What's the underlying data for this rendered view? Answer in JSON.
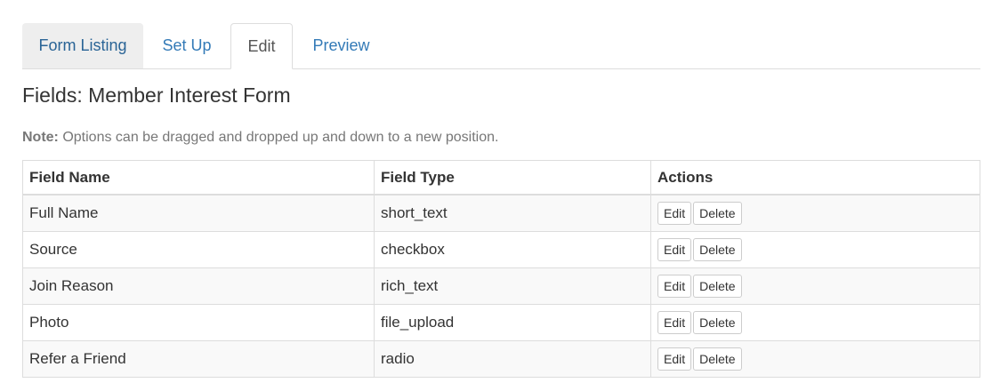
{
  "tabs": [
    {
      "label": "Form Listing"
    },
    {
      "label": "Set Up"
    },
    {
      "label": "Edit"
    },
    {
      "label": "Preview"
    }
  ],
  "page_title": "Fields: Member Interest Form",
  "note": {
    "label": "Note:",
    "text": " Options can be dragged and dropped up and down to a new position."
  },
  "table": {
    "headers": [
      "Field Name",
      "Field Type",
      "Actions"
    ],
    "rows": [
      {
        "name": "Full Name",
        "type": "short_text",
        "edit": "Edit",
        "delete": "Delete"
      },
      {
        "name": "Source",
        "type": "checkbox",
        "edit": "Edit",
        "delete": "Delete"
      },
      {
        "name": "Join Reason",
        "type": "rich_text",
        "edit": "Edit",
        "delete": "Delete"
      },
      {
        "name": "Photo",
        "type": "file_upload",
        "edit": "Edit",
        "delete": "Delete"
      },
      {
        "name": "Refer a Friend",
        "type": "radio",
        "edit": "Edit",
        "delete": "Delete"
      }
    ]
  },
  "colors": {
    "link": "#337ab7",
    "active_tab_bg": "#ffffff",
    "inactive_tab_bg": "#eeeeee",
    "border": "#dddddd",
    "striped_row": "#f9f9f9"
  }
}
